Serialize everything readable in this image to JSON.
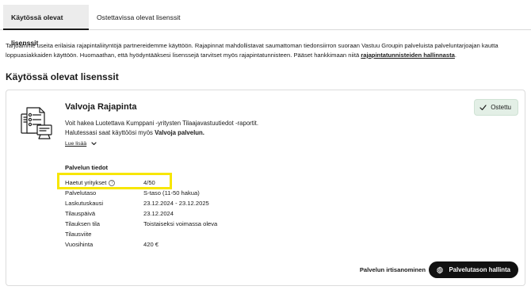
{
  "tabs": [
    {
      "label": "Käytössä olevat lisenssit",
      "active": true
    },
    {
      "label": "Ostettavissa olevat lisenssit",
      "active": false
    }
  ],
  "intro": {
    "text": "Tarjoamme useita erilaisia rajapintaliityntöjä partnereidemme käyttöön. Rajapinnat mahdollistavat saumattoman tiedonsiirron suoraan Vastuu Groupin palveluista palveluntarjoajan kautta loppuasiakkaiden käyttöön. Huomaathan, että hyödyntääksesi lisenssejä tarvitset myös rajapintatunnisteen. Pääset hankkimaan niitä ",
    "link": "rajapintatunnisteiden hallinnasta",
    "end": "."
  },
  "section_title": "Käytössä olevat lisenssit",
  "license": {
    "name": "Valvoja Rajapinta",
    "status": "Ostettu",
    "description_line1": "Voit hakea Luotettava Kumppani -yritysten Tilaajavastuutiedot -raportit.",
    "description_line2_prefix": "Halutessasi saat käyttöösi myös ",
    "description_line2_bold": "Valvoja palvelun.",
    "read_more": "Lue lisää",
    "details_title": "Palvelun tiedot",
    "details": [
      {
        "label": "Haetut yritykset",
        "value": "4/50",
        "help": true
      },
      {
        "label": "Palvelutaso",
        "value": "S-taso (11-50 hakua)"
      },
      {
        "label": "Laskutuskausi",
        "value": "23.12.2024 - 23.12.2025"
      },
      {
        "label": "Tilauspäivä",
        "value": "23.12.2024"
      },
      {
        "label": "Tilauksen tila",
        "value": "Toistaiseksi voimassa oleva"
      },
      {
        "label": "Tilausviite",
        "value": ""
      },
      {
        "label": "Vuosihinta",
        "value": "420 €"
      }
    ],
    "cancel_label": "Palvelun irtisanominen",
    "manage_label": "Palvelutason hallinta"
  },
  "colors": {
    "highlight": "#f7e600",
    "badge_bg": "#e3efe6",
    "button_bg": "#111111"
  }
}
